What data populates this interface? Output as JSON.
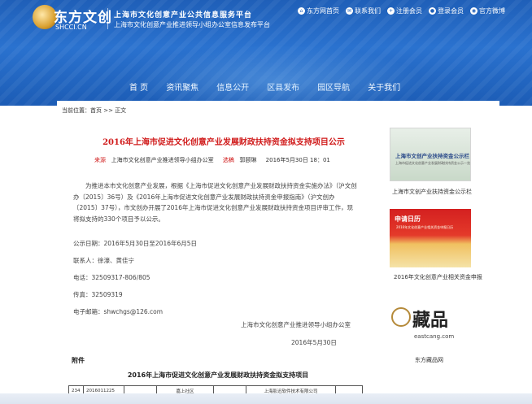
{
  "site": {
    "logo_cn": "东方文创",
    "logo_en": "SHCCI.CN",
    "title": "上海市文化创意产业公共信息服务平台",
    "subtitle": "上海市文化创意产业推进领导小组办公室信息发布平台"
  },
  "toplinks": [
    {
      "label": "东方网首页",
      "icon": "home-icon"
    },
    {
      "label": "联系我们",
      "icon": "contact-icon"
    },
    {
      "label": "注册会员",
      "icon": "register-icon"
    },
    {
      "label": "登录会员",
      "icon": "login-icon"
    },
    {
      "label": "官方微博",
      "icon": "weibo-icon"
    }
  ],
  "nav": [
    "首  页",
    "资讯聚焦",
    "信息公开",
    "区县发布",
    "园区导航",
    "关于我们"
  ],
  "breadcrumb": {
    "prefix": "当前位置：",
    "home": "首页",
    "sep1": " >> ",
    "current": "正文"
  },
  "article": {
    "title": "2016年上海市促进文化创意产业发展财政扶持资金拟支持项目公示",
    "source_label": "来源",
    "source_value": "上海市文化创意产业推进领导小组办公室",
    "author_label": "选稿",
    "author_value": "郭颐琳",
    "date": "2016年5月30日 18：01",
    "body": "为推进本市文化创意产业发展，根据《上海市促进文化创意产业发展财政扶持资金实施办法》（沪文创办〔2015〕36号）及《2016年上海市促进文化创意产业发展财政扶持资金申报指南》（沪文创办〔2015〕37号），市文创办开展了2016年上海市促进文化创意产业发展财政扶持资金项目评审工作，现将拟支持的330个项目予以公示。",
    "period": "公示日期：2016年5月30日至2016年6月5日",
    "contact": "联系人：徐濠、黄佳宁",
    "phone": "电话：32509317-806/805",
    "fax": "传真：32509319",
    "email": "电子邮箱：shwchgs@126.com",
    "sign_org": "上海市文化创意产业推进领导小组办公室",
    "sign_date": "2016年5月30日",
    "attachment_label": "附件",
    "attachment_title": "2016年上海市促进文化创意产业发展财政扶持资金拟支持项目",
    "table_row": [
      "234",
      "2016011225",
      "",
      "嘉上社区",
      "",
      "上海影迅软件技术有限公司",
      ""
    ]
  },
  "sidebar": [
    {
      "img_title": "上海市文创产业扶持资金公示栏",
      "img_sub": "上海市促进文化创意产业发展财政扶持资金公示一览",
      "caption": "上海市文创产业扶持资金公示栏"
    },
    {
      "img_title": "申请日历",
      "img_sub": "2016年文化创意产业相关资金申报日历",
      "caption": "2016年文化创意产业相关资金申报"
    },
    {
      "brand": "藏品",
      "url": "eastcang.com",
      "caption": "东方藏品网"
    }
  ]
}
